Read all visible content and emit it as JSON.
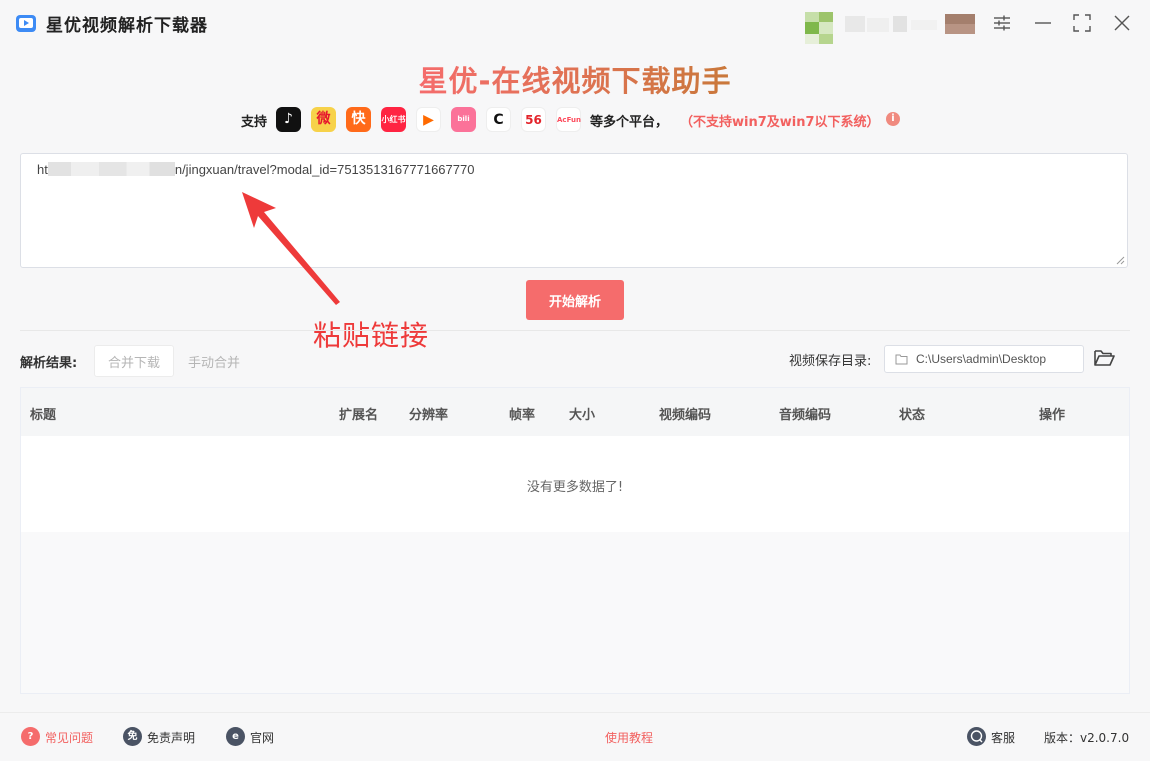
{
  "app": {
    "title": "星优视频解析下载器",
    "headline": "星优-在线视频下载助手"
  },
  "support": {
    "label": "支持",
    "platforms": [
      {
        "name": "douyin-icon",
        "text": "♪",
        "bg": "#111111",
        "fg": "#ffffff"
      },
      {
        "name": "weibo-icon",
        "text": "微",
        "bg": "#f7d24a",
        "fg": "#e6162d"
      },
      {
        "name": "kuaishou-icon",
        "text": "快",
        "bg": "#ff6a1a",
        "fg": "#ffffff"
      },
      {
        "name": "xiaohongshu-icon",
        "text": "小红书",
        "bg": "#ff2442",
        "fg": "#ffffff"
      },
      {
        "name": "tencent-video-icon",
        "text": "▶",
        "bg": "#ffffff",
        "fg": "#ff6a00"
      },
      {
        "name": "bilibili-icon",
        "text": "bili",
        "bg": "#fb7299",
        "fg": "#ffffff"
      },
      {
        "name": "cctv-icon",
        "text": "C",
        "bg": "#ffffff",
        "fg": "#111111"
      },
      {
        "name": "56-icon",
        "text": "56",
        "bg": "#ffffff",
        "fg": "#e3242b"
      },
      {
        "name": "acfun-icon",
        "text": "AcFun",
        "bg": "#ffffff",
        "fg": "#fd4c5d"
      }
    ],
    "tail": "等多个平台，",
    "warning": "（不支持win7及win7以下系统）",
    "info_icon": "i"
  },
  "url_input": {
    "prefix": "ht",
    "suffix": "n/jingxuan/travel?modal_id=7513513167771667770"
  },
  "parse_button": "开始解析",
  "annotation": "粘贴链接",
  "results": {
    "label": "解析结果:",
    "merge_download": "合并下载",
    "manual_merge": "手动合并",
    "save_dir_label": "视频保存目录:",
    "save_dir_value": "C:\\Users\\admin\\Desktop"
  },
  "table": {
    "columns": [
      "标题",
      "扩展名",
      "分辨率",
      "帧率",
      "大小",
      "视频编码",
      "音频编码",
      "状态",
      "操作"
    ],
    "empty_text": "没有更多数据了!"
  },
  "footer": {
    "faq": "常见问题",
    "faq_icon": "?",
    "disclaimer": "免责声明",
    "disclaimer_icon": "免",
    "website": "官网",
    "website_icon": "e",
    "tutorial": "使用教程",
    "support": "客服",
    "version": "版本：v2.0.7.0"
  },
  "colors": {
    "accent": "#f56c6c",
    "warning_text": "#f2605f",
    "annotation": "#ee3a3a",
    "headline_from": "#f56c6c",
    "headline_to": "#c9783a"
  }
}
